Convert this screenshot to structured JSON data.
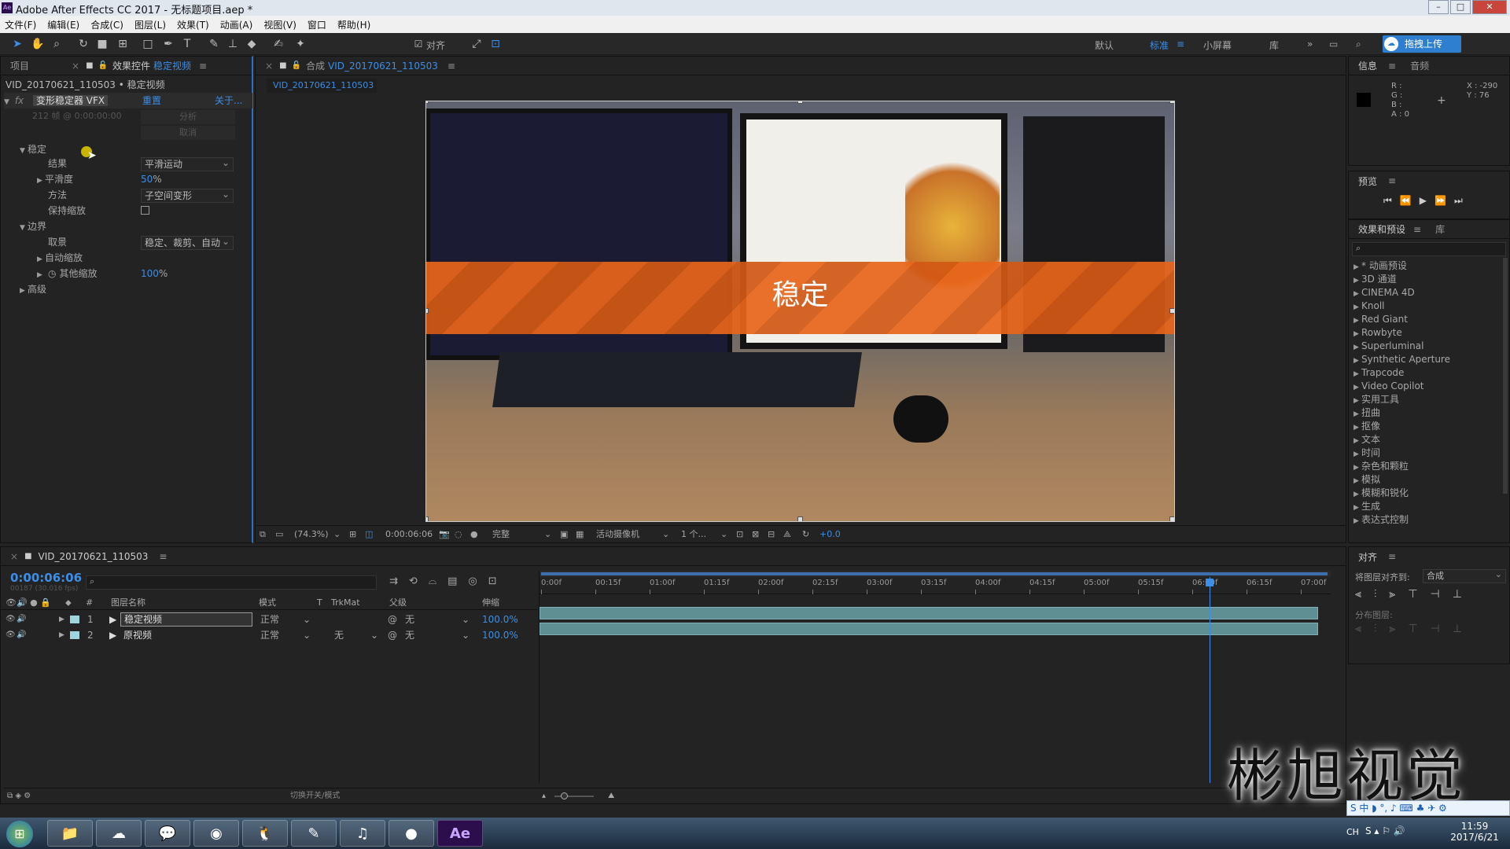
{
  "window": {
    "title": "Adobe After Effects CC 2017 - 无标题项目.aep *",
    "logo": "Ae"
  },
  "menu": [
    "文件(F)",
    "编辑(E)",
    "合成(C)",
    "图层(L)",
    "效果(T)",
    "动画(A)",
    "视图(V)",
    "窗口",
    "帮助(H)"
  ],
  "toolbar": {
    "snap_label": "对齐",
    "workspaces": [
      "默认",
      "标准",
      "小屏幕",
      "库"
    ],
    "active_workspace": "标准",
    "upload_label": "拖拽上传"
  },
  "left_panel": {
    "tab_project": "项目",
    "tab_effects": "效果控件",
    "tab_effects_layer": "稳定视频",
    "breadcrumb": "VID_20170621_110503 • 稳定视频",
    "effect_name": "变形稳定器 VFX",
    "reset": "重置",
    "about": "关于...",
    "frames_info": "212 帧 @ 0:00:00:00",
    "analyze": "分析",
    "cancel": "取消",
    "stabilize": "稳定",
    "result_label": "结果",
    "result_value": "平滑运动",
    "smoothness_label": "平滑度",
    "smoothness_value": "50",
    "smoothness_unit": "%",
    "method_label": "方法",
    "method_value": "子空间变形",
    "keep_scale_label": "保持缩放",
    "borders": "边界",
    "framing_label": "取景",
    "framing_value": "稳定、裁剪、自动",
    "auto_scale": "自动缩放",
    "additional_scale": "其他缩放",
    "additional_scale_value": "100",
    "additional_scale_unit": "%",
    "advanced": "高级"
  },
  "comp": {
    "tab_label": "合成",
    "tab_name": "VID_20170621_110503",
    "sub_tab": "VID_20170621_110503",
    "overlay_text": "稳定",
    "zoom": "(74.3%)",
    "timecode": "0:00:06:06",
    "resolution": "完整",
    "camera": "活动摄像机",
    "views": "1 个...",
    "exposure": "+0.0"
  },
  "info": {
    "tab_info": "信息",
    "tab_audio": "音频",
    "r": "R :",
    "g": "G :",
    "b": "B :",
    "a": "A : 0",
    "x": "X : -290",
    "y": "Y : 76"
  },
  "preview": {
    "title": "预览"
  },
  "effects_presets": {
    "title": "效果和预设",
    "tab_lib": "库",
    "items": [
      "* 动画预设",
      "3D 通道",
      "CINEMA 4D",
      "Knoll",
      "Red Giant",
      "Rowbyte",
      "Superluminal",
      "Synthetic Aperture",
      "Trapcode",
      "Video Copilot",
      "实用工具",
      "扭曲",
      "抠像",
      "文本",
      "时间",
      "杂色和颗粒",
      "模拟",
      "模糊和锐化",
      "生成",
      "表达式控制"
    ]
  },
  "align": {
    "title": "对齐",
    "align_to_label": "将图层对齐到:",
    "align_to_value": "合成",
    "distribute_label": "分布图层:"
  },
  "timeline": {
    "tab": "VID_20170621_110503",
    "timecode": "0:00:06:06",
    "fps": "00187 (30.016 fps)",
    "col_name": "图层名称",
    "col_mode": "模式",
    "col_t": "T",
    "col_trkmat": "TrkMat",
    "col_parent": "父级",
    "col_stretch": "伸缩",
    "ruler": [
      "0:00f",
      "00:15f",
      "01:00f",
      "01:15f",
      "02:00f",
      "02:15f",
      "03:00f",
      "03:15f",
      "04:00f",
      "04:15f",
      "05:00f",
      "05:15f",
      "06:00f",
      "06:15f",
      "07:00f"
    ],
    "playhead_fraction": 0.88,
    "layers": [
      {
        "num": "1",
        "name": "稳定视频",
        "mode": "正常",
        "trkmat": "",
        "parent": "无",
        "stretch": "100.0%"
      },
      {
        "num": "2",
        "name": "原视频",
        "mode": "正常",
        "trkmat": "无",
        "parent": "无",
        "stretch": "100.0%"
      }
    ],
    "toggle_label": "切换开关/模式"
  },
  "watermark": "彬旭视觉",
  "taskbar": {
    "lang": "CH",
    "time": "11:59",
    "date": "2017/6/21",
    "ae": "Ae"
  },
  "colors": {
    "accent": "#3d8ee6",
    "overlay": "#e8651a"
  }
}
